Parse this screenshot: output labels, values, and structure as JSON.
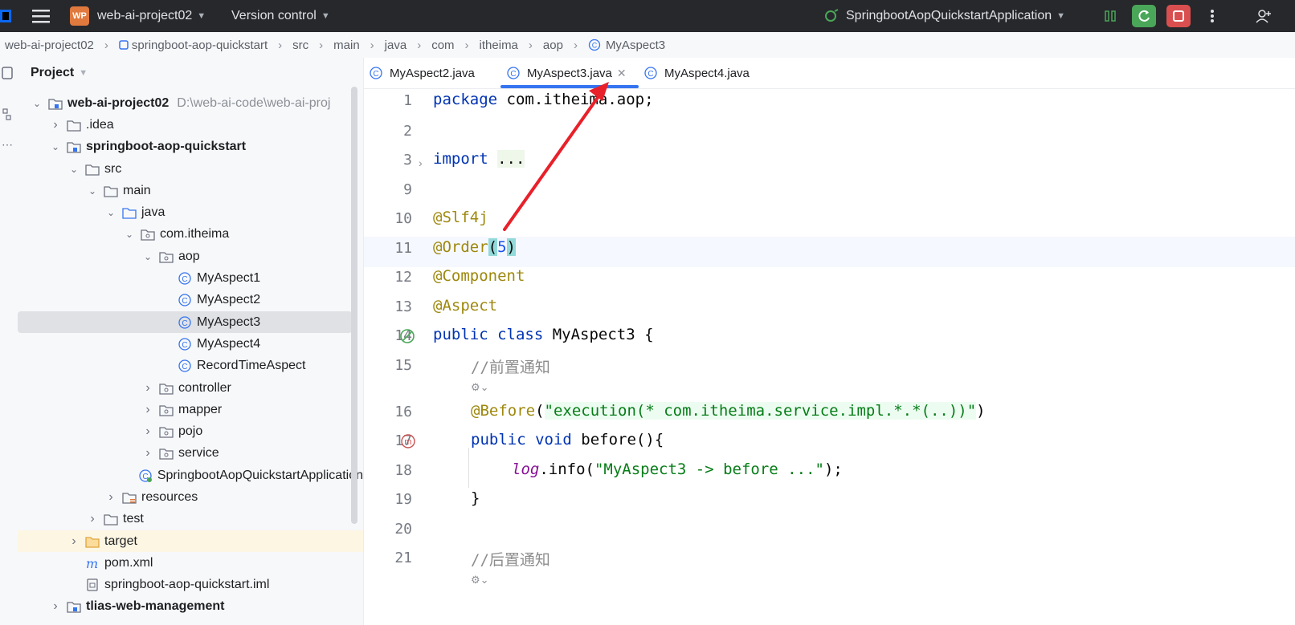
{
  "titlebar": {
    "badge": "WP",
    "project_name": "web-ai-project02",
    "vcs": "Version control",
    "run_config": "SpringbootAopQuickstartApplication"
  },
  "breadcrumb": [
    "web-ai-project02",
    "springboot-aop-quickstart",
    "src",
    "main",
    "java",
    "com",
    "itheima",
    "aop",
    "MyAspect3"
  ],
  "project_panel": {
    "title": "Project",
    "root_path": "D:\\web-ai-code\\web-ai-proj",
    "tree": [
      {
        "label": "web-ai-project02",
        "level": 0,
        "arrow": "open",
        "icon": "module-icon",
        "bold": true
      },
      {
        "label": ".idea",
        "level": 1,
        "arrow": "closed",
        "icon": "folder-icon"
      },
      {
        "label": "springboot-aop-quickstart",
        "level": 1,
        "arrow": "open",
        "icon": "module-icon",
        "bold": true
      },
      {
        "label": "src",
        "level": 2,
        "arrow": "open",
        "icon": "folder-icon"
      },
      {
        "label": "main",
        "level": 3,
        "arrow": "open",
        "icon": "folder-icon"
      },
      {
        "label": "java",
        "level": 4,
        "arrow": "open",
        "icon": "source-folder-icon"
      },
      {
        "label": "com.itheima",
        "level": 5,
        "arrow": "open",
        "icon": "package-icon"
      },
      {
        "label": "aop",
        "level": 6,
        "arrow": "open",
        "icon": "package-icon"
      },
      {
        "label": "MyAspect1",
        "level": 7,
        "arrow": "none",
        "icon": "class-icon"
      },
      {
        "label": "MyAspect2",
        "level": 7,
        "arrow": "none",
        "icon": "class-icon"
      },
      {
        "label": "MyAspect3",
        "level": 7,
        "arrow": "none",
        "icon": "class-icon",
        "selected": true
      },
      {
        "label": "MyAspect4",
        "level": 7,
        "arrow": "none",
        "icon": "class-icon"
      },
      {
        "label": "RecordTimeAspect",
        "level": 7,
        "arrow": "none",
        "icon": "class-icon"
      },
      {
        "label": "controller",
        "level": 6,
        "arrow": "closed",
        "icon": "package-icon"
      },
      {
        "label": "mapper",
        "level": 6,
        "arrow": "closed",
        "icon": "package-icon"
      },
      {
        "label": "pojo",
        "level": 6,
        "arrow": "closed",
        "icon": "package-icon"
      },
      {
        "label": "service",
        "level": 6,
        "arrow": "closed",
        "icon": "package-icon"
      },
      {
        "label": "SpringbootAopQuickstartApplication",
        "level": 6,
        "arrow": "none",
        "icon": "spring-boot-class-icon"
      },
      {
        "label": "resources",
        "level": 4,
        "arrow": "closed",
        "icon": "resources-folder-icon"
      },
      {
        "label": "test",
        "level": 3,
        "arrow": "closed",
        "icon": "folder-icon"
      },
      {
        "label": "target",
        "level": 2,
        "arrow": "closed",
        "icon": "excluded-folder-icon",
        "highlight": true
      },
      {
        "label": "pom.xml",
        "level": 2,
        "arrow": "none",
        "icon": "maven-icon"
      },
      {
        "label": "springboot-aop-quickstart.iml",
        "level": 2,
        "arrow": "none",
        "icon": "iml-file-icon"
      },
      {
        "label": "tlias-web-management",
        "level": 1,
        "arrow": "closed",
        "icon": "module-icon",
        "bold": true
      }
    ]
  },
  "tabs": [
    {
      "label": "MyAspect2.java"
    },
    {
      "label": "MyAspect3.java",
      "active": true
    },
    {
      "label": "MyAspect4.java"
    }
  ],
  "editor": {
    "line_numbers": [
      "1",
      "2",
      "3",
      "9",
      "10",
      "11",
      "12",
      "13",
      "14",
      "15",
      "16",
      "17",
      "18",
      "19",
      "20",
      "21"
    ],
    "code": {
      "l1_kw": "package",
      "l1_rest": " com.itheima.aop;",
      "l3_kw": "import",
      "l3_fold": "...",
      "l10": "@Slf4j",
      "l11_ann": "@Order",
      "l11_open": "(",
      "l11_num": "5",
      "l11_close": ")",
      "l12": "@Component",
      "l13": "@Aspect",
      "l14_kw": "public class",
      "l14_rest": " MyAspect3 {",
      "l15": "//前置通知",
      "l16_ann": "@Before",
      "l16_open": "(",
      "l16_str": "\"execution(* com.itheima.service.impl.*.*(..))\"",
      "l16_close": ")",
      "l17_kw": "public void",
      "l17_rest": " before(){",
      "l18_log": "log",
      "l18_mid": ".info(",
      "l18_str": "\"MyAspect3 -> before ...\"",
      "l18_end": ");",
      "l19": "}",
      "l21": "//后置通知"
    }
  },
  "colors": {
    "titlebar_bg": "#27282c",
    "accent_blue": "#3574f0",
    "annotation_arrow": "#e8202a",
    "run_green": "#4aa658",
    "stop_red": "#d94f4f"
  }
}
